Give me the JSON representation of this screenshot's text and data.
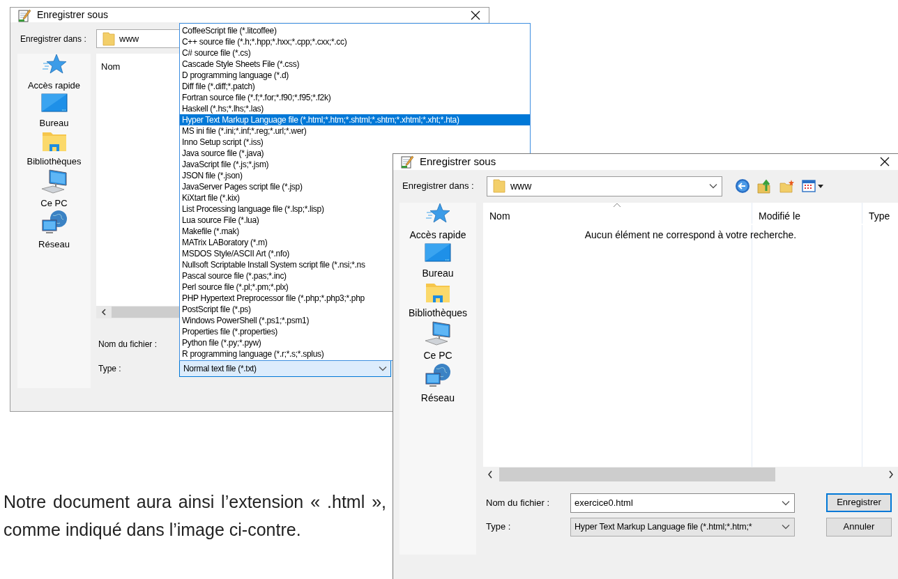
{
  "dialog_back": {
    "title": "Enregistrer sous",
    "save_in_label": "Enregistrer dans :",
    "save_in_value": "www",
    "places": [
      {
        "label": "Accès rapide",
        "kind": "star"
      },
      {
        "label": "Bureau",
        "kind": "desktop"
      },
      {
        "label": "Bibliothèques",
        "kind": "library"
      },
      {
        "label": "Ce PC",
        "kind": "computer"
      },
      {
        "label": "Réseau",
        "kind": "network"
      }
    ],
    "column_header": "Nom",
    "file_name_label": "Nom du fichier :",
    "type_label": "Type :",
    "type_value": "Normal text file (*.txt)",
    "type_dropdown": {
      "items": [
        {
          "label": "CoffeeScript file (*.litcoffee)",
          "selected": false
        },
        {
          "label": "C++ source file (*.h;*.hpp;*.hxx;*.cpp;*.cxx;*.cc)",
          "selected": false
        },
        {
          "label": "C# source file (*.cs)",
          "selected": false
        },
        {
          "label": "Cascade Style Sheets File (*.css)",
          "selected": false
        },
        {
          "label": "D programming language (*.d)",
          "selected": false
        },
        {
          "label": "Diff file (*.diff;*.patch)",
          "selected": false
        },
        {
          "label": "Fortran source file (*.f;*.for;*.f90;*.f95;*.f2k)",
          "selected": false
        },
        {
          "label": "Haskell (*.hs;*.lhs;*.las)",
          "selected": false
        },
        {
          "label": "Hyper Text Markup Language file (*.html;*.htm;*.shtml;*.shtm;*.xhtml;*.xht;*.hta)",
          "selected": true
        },
        {
          "label": "MS ini file (*.ini;*.inf;*.reg;*.url;*.wer)",
          "selected": false
        },
        {
          "label": "Inno Setup script (*.iss)",
          "selected": false
        },
        {
          "label": "Java source file (*.java)",
          "selected": false
        },
        {
          "label": "JavaScript file (*.js;*.jsm)",
          "selected": false
        },
        {
          "label": "JSON file (*.json)",
          "selected": false
        },
        {
          "label": "JavaServer Pages script file (*.jsp)",
          "selected": false
        },
        {
          "label": "KiXtart file (*.kix)",
          "selected": false
        },
        {
          "label": "List Processing language file (*.lsp;*.lisp)",
          "selected": false
        },
        {
          "label": "Lua source File (*.lua)",
          "selected": false
        },
        {
          "label": "Makefile (*.mak)",
          "selected": false
        },
        {
          "label": "MATrix LABoratory (*.m)",
          "selected": false
        },
        {
          "label": "MSDOS Style/ASCII Art (*.nfo)",
          "selected": false
        },
        {
          "label": "Nullsoft Scriptable Install System script file (*.nsi;*.ns",
          "selected": false
        },
        {
          "label": "Pascal source file (*.pas;*.inc)",
          "selected": false
        },
        {
          "label": "Perl source file (*.pl;*.pm;*.plx)",
          "selected": false
        },
        {
          "label": "PHP Hypertext Preprocessor file (*.php;*.php3;*.php",
          "selected": false
        },
        {
          "label": "PostScript file (*.ps)",
          "selected": false
        },
        {
          "label": "Windows PowerShell (*.ps1;*.psm1)",
          "selected": false
        },
        {
          "label": "Properties file (*.properties)",
          "selected": false
        },
        {
          "label": "Python file (*.py;*.pyw)",
          "selected": false
        },
        {
          "label": "R programming language (*.r;*.s;*.splus)",
          "selected": false
        }
      ]
    }
  },
  "dialog_front": {
    "title": "Enregistrer sous",
    "save_in_label": "Enregistrer dans :",
    "save_in_value": "www",
    "places": [
      {
        "label": "Accès rapide",
        "kind": "star"
      },
      {
        "label": "Bureau",
        "kind": "desktop"
      },
      {
        "label": "Bibliothèques",
        "kind": "library"
      },
      {
        "label": "Ce PC",
        "kind": "computer"
      },
      {
        "label": "Réseau",
        "kind": "network"
      }
    ],
    "columns": [
      "Nom",
      "Modifié le",
      "Type"
    ],
    "empty_message": "Aucun élément ne correspond à votre recherche.",
    "file_name_label": "Nom du fichier :",
    "file_name_value": "exercice0.html",
    "type_label": "Type :",
    "type_value": "Hyper Text Markup Language file (*.html;*.htm;*",
    "buttons": [
      {
        "label": "Enregistrer",
        "default": true
      },
      {
        "label": "Annuler",
        "default": false
      }
    ]
  },
  "paragraph": "Notre document aura ainsi l’extension « .html », comme indiqué dans l’image ci-contre."
}
